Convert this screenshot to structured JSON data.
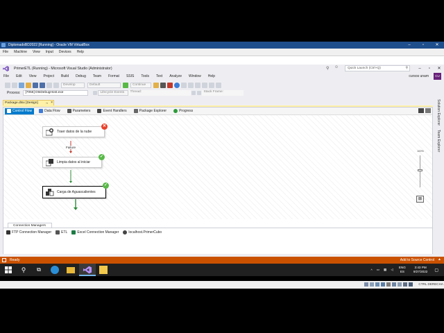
{
  "vbox": {
    "title": "DiplomadoBD2022 [Running] - Oracle VM VirtualBox",
    "menu": [
      "File",
      "Machine",
      "View",
      "Input",
      "Devices",
      "Help"
    ],
    "status_host_key": "CTRL DERECHA"
  },
  "vs": {
    "title": "PrimerETL (Running) - Microsoft Visual Studio  (Administrator)",
    "quick_launch_placeholder": "Quick Launch (Ctrl+Q)",
    "user": "cursos unam",
    "avatar": "CU",
    "menu": [
      "File",
      "Edit",
      "View",
      "Project",
      "Build",
      "Debug",
      "Team",
      "Format",
      "SSIS",
      "Tools",
      "Text",
      "Analyze",
      "Window",
      "Help"
    ],
    "toolbar": {
      "config": "Develop",
      "platform": "Default",
      "continue_label": "Continue"
    },
    "process": {
      "label": "Process:",
      "value": "[7056] DtsDebugHost.exe",
      "lifecycle": "Lifecycle Events",
      "thread": "Thread:",
      "stack": "Stack Frame:"
    },
    "doc_tab": "Package.dtsx [Design]",
    "designer_tabs": [
      {
        "label": "Control Flow",
        "active": true,
        "color": "#ffffff"
      },
      {
        "label": "Data Flow",
        "active": false,
        "color": "#3d7bd9"
      },
      {
        "label": "Parameters",
        "active": false,
        "color": "#555555"
      },
      {
        "label": "Event Handlers",
        "active": false,
        "color": "#444444"
      },
      {
        "label": "Package Explorer",
        "active": false,
        "color": "#666666"
      },
      {
        "label": "Progress",
        "active": false,
        "color": "#2e9b3a"
      }
    ],
    "tasks": [
      {
        "name": "Traer datos de la nube",
        "status": "error"
      },
      {
        "name": "Limpia datos al iniciar",
        "status": "success"
      },
      {
        "name": "Carga de Aguascalientes",
        "status": "success"
      }
    ],
    "constraint_label": "Failure",
    "zoom_label": "100%",
    "connection_managers_tab": "Connection Managers",
    "connections": [
      "FTP Connection Manager",
      "ETL",
      "Excel Connection Manager",
      "localhost.PrimerCubo"
    ],
    "side_panels": [
      "Solution Explorer",
      "Team Explorer"
    ],
    "status": {
      "left": "Ready",
      "right": "Add to Source Control"
    }
  },
  "taskbar": {
    "lang_top": "ENG",
    "lang_bottom": "ES",
    "time": "3:43 PM",
    "date": "9/27/2022"
  },
  "colors": {
    "vs_status": "#ca5100",
    "accent": "#007acc",
    "error": "#e8412b",
    "success": "#58b947",
    "failure_line": "#c0392b",
    "success_line": "#2e8b3a"
  }
}
